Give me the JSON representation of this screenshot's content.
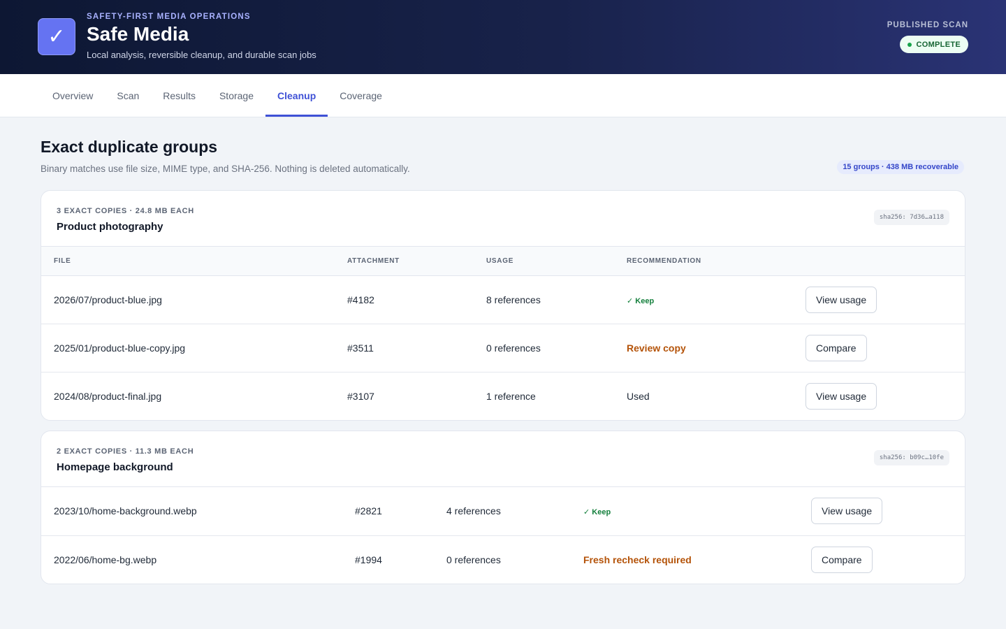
{
  "header": {
    "eyebrow": "SAFETY-FIRST MEDIA OPERATIONS",
    "title": "Safe Media",
    "subtitle": "Local analysis, reversible cleanup, and durable scan jobs",
    "logo_glyph": "✓",
    "scan_label": "PUBLISHED SCAN",
    "scan_status": "COMPLETE"
  },
  "tabs": [
    {
      "label": "Overview",
      "active": false
    },
    {
      "label": "Scan",
      "active": false
    },
    {
      "label": "Results",
      "active": false
    },
    {
      "label": "Storage",
      "active": false
    },
    {
      "label": "Cleanup",
      "active": true
    },
    {
      "label": "Coverage",
      "active": false
    }
  ],
  "section": {
    "title": "Exact duplicate groups",
    "description": "Binary matches use file size, MIME type, and SHA-256. Nothing is deleted automatically.",
    "summary": "15 groups · 438 MB recoverable"
  },
  "groups": [
    {
      "kicker": "3 EXACT COPIES · 24.8 MB EACH",
      "title": "Product photography",
      "hash": "sha256: 7d36…a118",
      "columns": [
        "FILE",
        "ATTACHMENT",
        "USAGE",
        "RECOMMENDATION",
        ""
      ],
      "rows": [
        {
          "file": "2026/07/product-blue.jpg",
          "attachment": "#4182",
          "usage": "8 references",
          "recommendation": "✓ Keep",
          "rec_type": "keep",
          "action": "View usage"
        },
        {
          "file": "2025/01/product-blue-copy.jpg",
          "attachment": "#3511",
          "usage": "0 references",
          "recommendation": "Review copy",
          "rec_type": "review",
          "action": "Compare"
        },
        {
          "file": "2024/08/product-final.jpg",
          "attachment": "#3107",
          "usage": "1 reference",
          "recommendation": "Used",
          "rec_type": "used",
          "action": "View usage"
        }
      ]
    },
    {
      "kicker": "2 EXACT COPIES · 11.3 MB EACH",
      "title": "Homepage background",
      "hash": "sha256: b09c…10fe",
      "rows": [
        {
          "file": "2023/10/home-background.webp",
          "attachment": "#2821",
          "usage": "4 references",
          "recommendation": "✓ Keep",
          "rec_type": "keep",
          "action": "View usage"
        },
        {
          "file": "2022/06/home-bg.webp",
          "attachment": "#1994",
          "usage": "0 references",
          "recommendation": "Fresh recheck required",
          "rec_type": "review",
          "action": "Compare"
        }
      ]
    }
  ]
}
